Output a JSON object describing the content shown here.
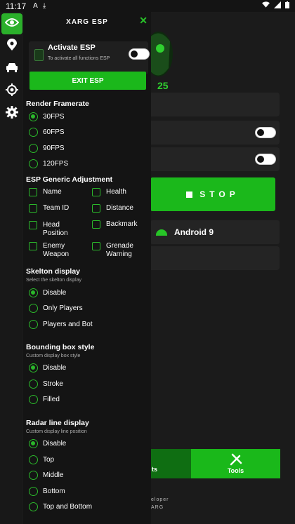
{
  "status_bar": {
    "time": "11:17",
    "icons": [
      "A",
      "download-icon"
    ]
  },
  "background": {
    "stop_label": "STOP",
    "android_label": "Android 9",
    "tabs": {
      "left_partial": "ts",
      "tools": "Tools"
    },
    "footer_lines": [
      "eloper",
      "ARG"
    ]
  },
  "panel": {
    "title": "XARG ESP",
    "activate": {
      "title": "Activate ESP",
      "subtitle": "To activate all functions ESP"
    },
    "exit_label": "EXIT ESP",
    "framerate": {
      "title": "Render Framerate",
      "options": [
        "30FPS",
        "60FPS",
        "90FPS",
        "120FPS"
      ],
      "selected": "30FPS"
    },
    "generic": {
      "title": "ESP Generic Adjustment",
      "items_left": [
        "Name",
        "Team ID",
        "Head\nPosition",
        "Enemy\nWeapon"
      ],
      "items_right": [
        "Health",
        "Distance",
        "Backmark",
        "Grenade\nWarning"
      ]
    },
    "skeleton": {
      "title": "Skelton display",
      "subtitle": "Select the skelton display",
      "options": [
        "Disable",
        "Only Players",
        "Players and Bot"
      ],
      "selected": "Disable"
    },
    "bbox": {
      "title": "Bounding box style",
      "subtitle": "Custom display box style",
      "options": [
        "Disable",
        "Stroke",
        "Filled"
      ],
      "selected": "Disable"
    },
    "radar": {
      "title": "Radar line display",
      "subtitle": "Custom display line position",
      "options": [
        "Disable",
        "Top",
        "Middle",
        "Bottom",
        "Top and Bottom"
      ],
      "selected": "Disable"
    }
  },
  "colors": {
    "accent": "#1bb81b",
    "dark_accent": "#0f6e12",
    "bg": "#141414"
  }
}
